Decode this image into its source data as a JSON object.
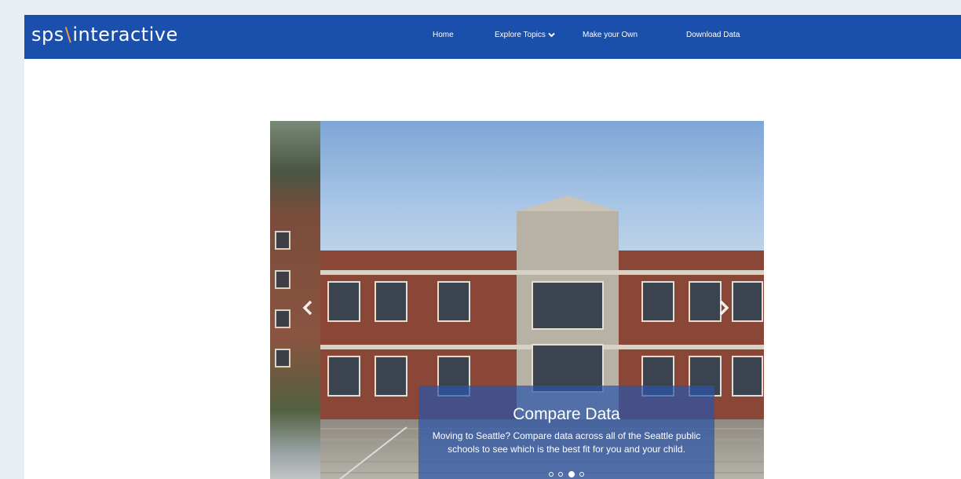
{
  "brand": {
    "part1": "sps",
    "slash": "\\",
    "part2": "interactive"
  },
  "nav": {
    "home": "Home",
    "explore": "Explore Topics",
    "make": "Make your Own",
    "download": "Download Data"
  },
  "colors": {
    "navbar": "#1b4fac",
    "brand_slash": "#f0a040",
    "background": "#e9edf4"
  },
  "icons": {
    "explore_dropdown": "chevron-down-icon",
    "carousel_prev": "chevron-left-icon",
    "carousel_next": "chevron-right-icon"
  },
  "carousel": {
    "caption_title": "Compare Data",
    "caption_text": "Moving to Seattle? Compare data across all of the Seattle public schools to see which is the best fit for you and your child.",
    "active_index": 3,
    "total": 4
  }
}
